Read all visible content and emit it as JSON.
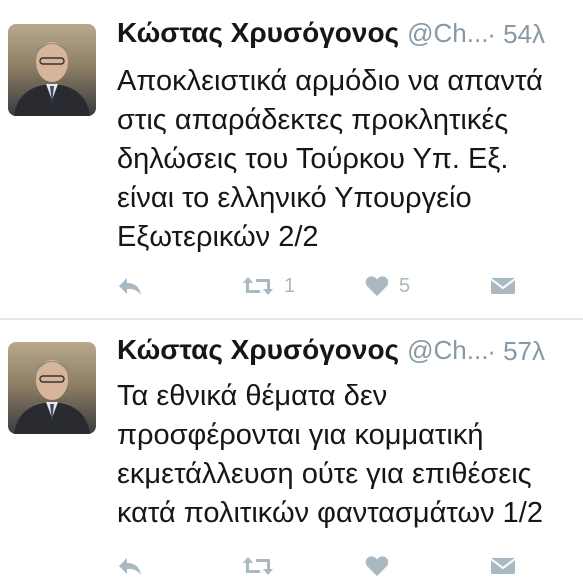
{
  "timeline": {
    "tweets": [
      {
        "author_name": "Κώστας Χρυσόγονος",
        "handle": "@Ch...",
        "time": "· 54λ",
        "text": "Αποκλειστικά αρμόδιο να απαντά\nστις απαράδεκτες προκλητικές\nδηλώσεις του Τούρκου Υπ. Εξ.\nείναι το ελληνικό Υπουργείο\nΕξωτερικών 2/2",
        "retweet_count": "1",
        "like_count": "5"
      },
      {
        "author_name": "Κώστας Χρυσόγονος",
        "handle": "@Ch...",
        "time": "· 57λ",
        "text": "Τα εθνικά θέματα δεν\nπροσφέρονται για κομματική\nεκμετάλλευση ούτε για επιθέσεις\nκατά πολιτικών φαντασμάτων 1/2",
        "retweet_count": "",
        "like_count": ""
      }
    ]
  },
  "icons": {
    "reply": "reply-arrow-icon",
    "retweet": "retweet-icon",
    "like": "heart-icon",
    "dm": "envelope-icon"
  },
  "colors": {
    "name": "#14171a",
    "muted": "#8899a6",
    "icon": "#aab8c2",
    "divider": "#e1e8ed"
  }
}
